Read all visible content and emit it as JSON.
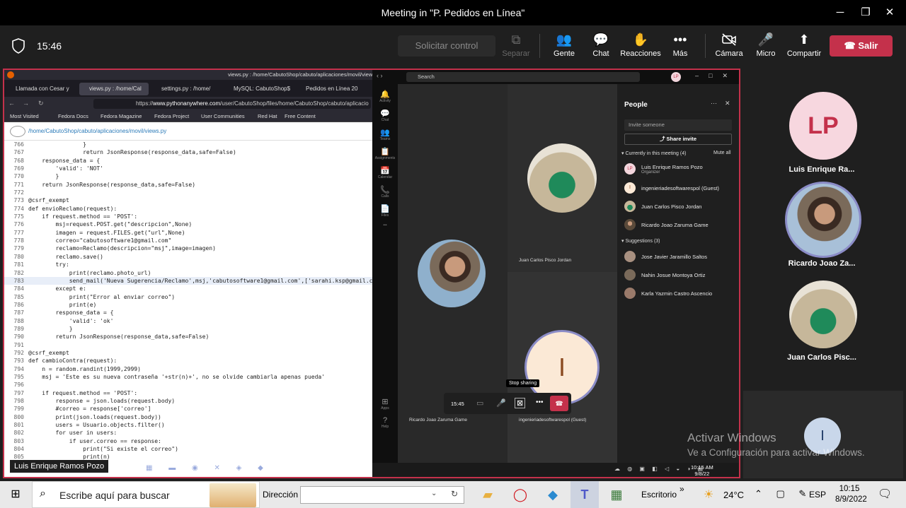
{
  "window": {
    "title": "Meeting in \"P. Pedidos en Línea\"",
    "minimize": "─",
    "maximize": "❐",
    "close": "✕"
  },
  "toolbar": {
    "timer": "15:46",
    "request_control": "Solicitar control",
    "items": [
      {
        "label": "Separar",
        "icon": "⧉"
      },
      {
        "label": "Gente",
        "icon": "👥"
      },
      {
        "label": "Chat",
        "icon": "💬"
      },
      {
        "label": "Reacciones",
        "icon": "✋"
      },
      {
        "label": "Más",
        "icon": "•••"
      },
      {
        "label": "Cámara",
        "icon": "🚫"
      },
      {
        "label": "Micro",
        "icon": "🎤"
      },
      {
        "label": "Compartir",
        "icon": "⬆"
      }
    ],
    "leave": "Salir",
    "leave_color": "#c4314b"
  },
  "shared_screen": {
    "firefox": {
      "title": "views.py : /home/CabutoShop/cabuto/aplicaciones/movil/views",
      "tabs": [
        "Llamada con Cesar y",
        "views.py : /home/Cal",
        "settings.py : /home/",
        "MySQL: CabutoShop$",
        "Pedidos en Línea 20"
      ],
      "url_prefix": "https://",
      "url_domain": "www.pythonanywhere.com",
      "url_rest": "/user/CabutoShop/files/home/CabutoShop/cabuto/aplicacio",
      "bookmarks": [
        "Most Visited",
        "Fedora Docs",
        "Fedora Magazine",
        "Fedora Project",
        "User Communities",
        "Red Hat",
        "Free Content"
      ],
      "path": "/home/CabutoShop/cabuto/aplicaciones/movil/views.py",
      "code_lines": [
        {
          "n": "766",
          "t": "                }"
        },
        {
          "n": "767",
          "t": "                return JsonResponse(response_data,safe=False)"
        },
        {
          "n": "768",
          "t": "    response_data = {"
        },
        {
          "n": "769",
          "t": "        'valid': 'NOT'"
        },
        {
          "n": "770",
          "t": "        }"
        },
        {
          "n": "771",
          "t": "    return JsonResponse(response_data,safe=False)"
        },
        {
          "n": "772",
          "t": ""
        },
        {
          "n": "773",
          "t": "@csrf_exempt"
        },
        {
          "n": "774",
          "t": "def envioReclamo(request):"
        },
        {
          "n": "775",
          "t": "    if request.method == 'POST':"
        },
        {
          "n": "776",
          "t": "        msj=request.POST.get(\"descripcion\",None)"
        },
        {
          "n": "777",
          "t": "        imagen = request.FILES.get(\"url\",None)"
        },
        {
          "n": "778",
          "t": "        correo=\"cabutosoftware1@gmail.com\""
        },
        {
          "n": "779",
          "t": "        reclamo=Reclamo(descripcion=\"msj\",image=imagen)"
        },
        {
          "n": "780",
          "t": "        reclamo.save()"
        },
        {
          "n": "781",
          "t": "        try:"
        },
        {
          "n": "782",
          "t": "            print(reclamo.photo_url)"
        },
        {
          "n": "783",
          "t": "            send_mail('Nueva Sugerencia/Reclamo',msj,'cabutosoftware1@gmail.com',['sarahi.ksp@gmail.c"
        },
        {
          "n": "784",
          "t": "        except e:"
        },
        {
          "n": "785",
          "t": "            print(\"Error al enviar correo\")"
        },
        {
          "n": "786",
          "t": "            print(e)"
        },
        {
          "n": "787",
          "t": "        response_data = {"
        },
        {
          "n": "788",
          "t": "            'valid': 'ok'"
        },
        {
          "n": "789",
          "t": "            }"
        },
        {
          "n": "790",
          "t": "        return JsonResponse(response_data,safe=False)"
        },
        {
          "n": "791",
          "t": ""
        },
        {
          "n": "792",
          "t": "@csrf_exempt"
        },
        {
          "n": "793",
          "t": "def cambioContra(request):"
        },
        {
          "n": "794",
          "t": "    n = random.randint(1999,2999)"
        },
        {
          "n": "795",
          "t": "    msj = 'Este es su nueva contraseña '+str(n)+', no se olvide cambiarla apenas pueda'"
        },
        {
          "n": "796",
          "t": ""
        },
        {
          "n": "797",
          "t": "    if request.method == 'POST':"
        },
        {
          "n": "798",
          "t": "        response = json.loads(request.body)"
        },
        {
          "n": "799",
          "t": "        #correo = response['correo']"
        },
        {
          "n": "800",
          "t": "        print(json.loads(request.body))"
        },
        {
          "n": "801",
          "t": "        users = Usuario.objects.filter()"
        },
        {
          "n": "802",
          "t": "        for user in users:"
        },
        {
          "n": "803",
          "t": "            if user.correo == response:"
        },
        {
          "n": "804",
          "t": "                print(\"Si existe el correo\")"
        },
        {
          "n": "805",
          "t": "                print(n)"
        }
      ],
      "presenter_label": "Luis Enrique Ramos Pozo"
    },
    "teams": {
      "search": "Search",
      "rail": [
        "Activity",
        "Chat",
        "Teams",
        "Assignments",
        "Calendar",
        "Calls",
        "Files",
        "•••",
        "Apps",
        "Help"
      ],
      "tiles": [
        {
          "name": "Juan Carlos Pisco Jordan"
        },
        {
          "name": "Ricardo Joao Zaruma Game"
        },
        {
          "name": "ingenieriadesoftwarespol (Guest)",
          "initial": "I"
        }
      ],
      "call_bar": {
        "time": "15:45",
        "tooltip": "Stop sharing"
      },
      "people": {
        "title": "People",
        "invite_placeholder": "Invite someone",
        "share_invite": "Share invite",
        "current_heading": "Currently in this meeting (4)",
        "mute_all": "Mute all",
        "current": [
          {
            "name": "Luis Enrique Ramos Pozo",
            "sub": "Organizer",
            "initials": "LP"
          },
          {
            "name": "ingenieriadesoftwarespol (Guest)",
            "sub": "",
            "initials": "I"
          },
          {
            "name": "Juan Carlos Pisco Jordan",
            "sub": "",
            "initials": ""
          },
          {
            "name": "Ricardo Joao Zaruma Game",
            "sub": "",
            "initials": ""
          }
        ],
        "suggestions_heading": "Suggestions (3)",
        "suggestions": [
          {
            "name": "Jose Javier Jaramillo Saltos"
          },
          {
            "name": "Nahin Josue Montoya Ortiz"
          },
          {
            "name": "Karla Yazmin Castro Ascencio"
          }
        ]
      },
      "clock_time": "10:15 AM",
      "clock_date": "9/8/22"
    }
  },
  "gallery": [
    {
      "name": "Luis Enrique Ra...",
      "initials": "LP"
    },
    {
      "name": "Ricardo Joao Za..."
    },
    {
      "name": "Juan Carlos Pisc..."
    }
  ],
  "self_tile_initial": "I",
  "watermark": {
    "line1": "Activar Windows",
    "line2": "Ve a Configuración para activar Windows."
  },
  "taskbar": {
    "search_placeholder": "Escribe aquí para buscar",
    "address_label": "Dirección",
    "desktop_label": "Escritorio",
    "temperature": "24°C",
    "language": "ESP",
    "time": "10:15",
    "date": "8/9/2022"
  }
}
